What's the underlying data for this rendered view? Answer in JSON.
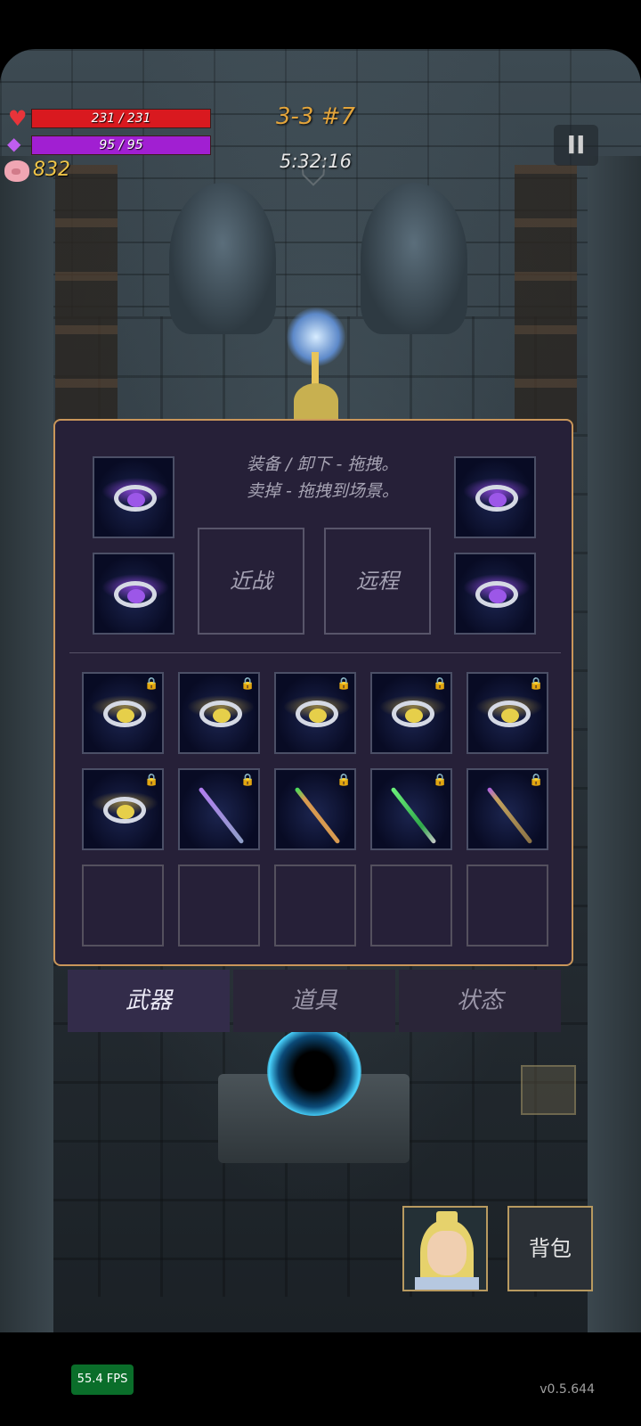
{
  "hud": {
    "hp_text": "231 / 231",
    "hp_fraction": 1.0,
    "mp_text": "95 / 95",
    "mp_fraction": 1.0,
    "gold": "832",
    "stage": "3-3 #7",
    "timer": "5:32:16",
    "pause_icon": "pause-icon"
  },
  "inventory": {
    "hint_line1": "装备 / 卸下 - 拖拽。",
    "hint_line2": "卖掉 - 拖拽到场景。",
    "melee_label": "近战",
    "ranged_label": "远程",
    "equipped_rings": [
      "purple-flower-ring",
      "purple-flower-ring",
      "purple-flower-ring",
      "purple-flower-ring"
    ],
    "row1": [
      "gold-ring",
      "gold-ring",
      "gold-ring",
      "gold-ring",
      "gold-ring"
    ],
    "row2": [
      "gold-ring",
      "purple-staff",
      "green-staff",
      "green-sword",
      "purple-gem-staff"
    ],
    "locked": true
  },
  "tabs": [
    {
      "label": "武器",
      "active": true
    },
    {
      "label": "道具",
      "active": false
    },
    {
      "label": "状态",
      "active": false
    }
  ],
  "bottom": {
    "bag_label": "背包",
    "fps": "55.4 FPS",
    "version": "v0.5.644"
  },
  "colors": {
    "hp": "#d9191f",
    "mp": "#a11fd2",
    "gold": "#f0c548",
    "stage": "#e2a43b",
    "panel_border": "#c9965a"
  }
}
